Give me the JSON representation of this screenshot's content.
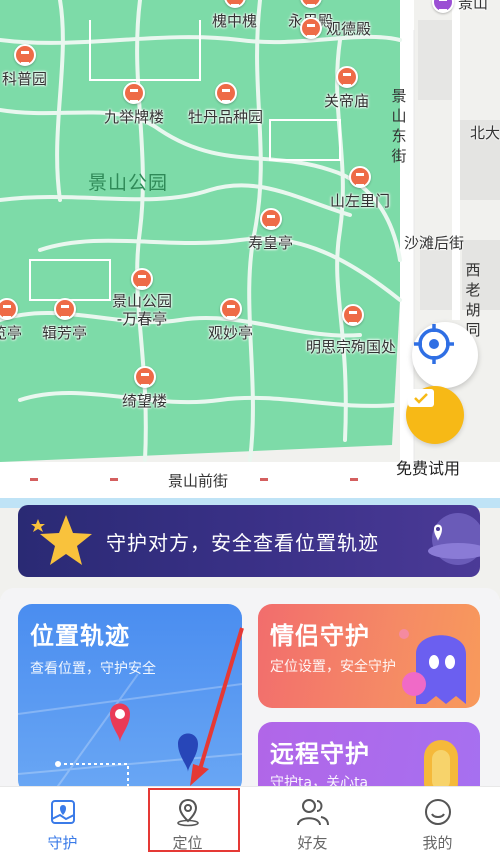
{
  "map": {
    "park_name": "景山公园",
    "road_label": "景山前街",
    "pois": [
      {
        "label": "槐中槐"
      },
      {
        "label": "永思殿"
      },
      {
        "label": "景山"
      },
      {
        "label": "科普园"
      },
      {
        "label": "观德殿"
      },
      {
        "label": "九举牌楼"
      },
      {
        "label": "牡丹品种园"
      },
      {
        "label": "关帝庙"
      },
      {
        "label": "山左里门"
      },
      {
        "label": "寿皇亭"
      },
      {
        "label": "景山公园\n-万春亭"
      },
      {
        "label": "辑芳亭"
      },
      {
        "label": "览亭"
      },
      {
        "label": "观妙亭"
      },
      {
        "label": "明思宗殉国处"
      },
      {
        "label": "绮望楼"
      }
    ],
    "street_labels": {
      "jingshan_east": "景山东街",
      "beida": "北大",
      "shatan": "沙滩后街",
      "xilao": "西老胡同"
    },
    "trial_label": "免费试用"
  },
  "banner": {
    "text": "守护对方，安全查看位置轨迹"
  },
  "cards": {
    "track": {
      "title": "位置轨迹",
      "subtitle": "查看位置，守护安全"
    },
    "couple": {
      "title": "情侣守护",
      "subtitle": "定位设置，安全守护"
    },
    "remote": {
      "title": "远程守护",
      "subtitle": "守护ta，关心ta"
    }
  },
  "tabs": [
    {
      "label": "守护",
      "active": true
    },
    {
      "label": "定位",
      "active": false
    },
    {
      "label": "好友",
      "active": false
    },
    {
      "label": "我的",
      "active": false
    }
  ],
  "colors": {
    "accent": "#3b7be8",
    "map_green": "#7ddba8",
    "poi_pin": "#ee6b47",
    "highlight": "#e53935"
  }
}
